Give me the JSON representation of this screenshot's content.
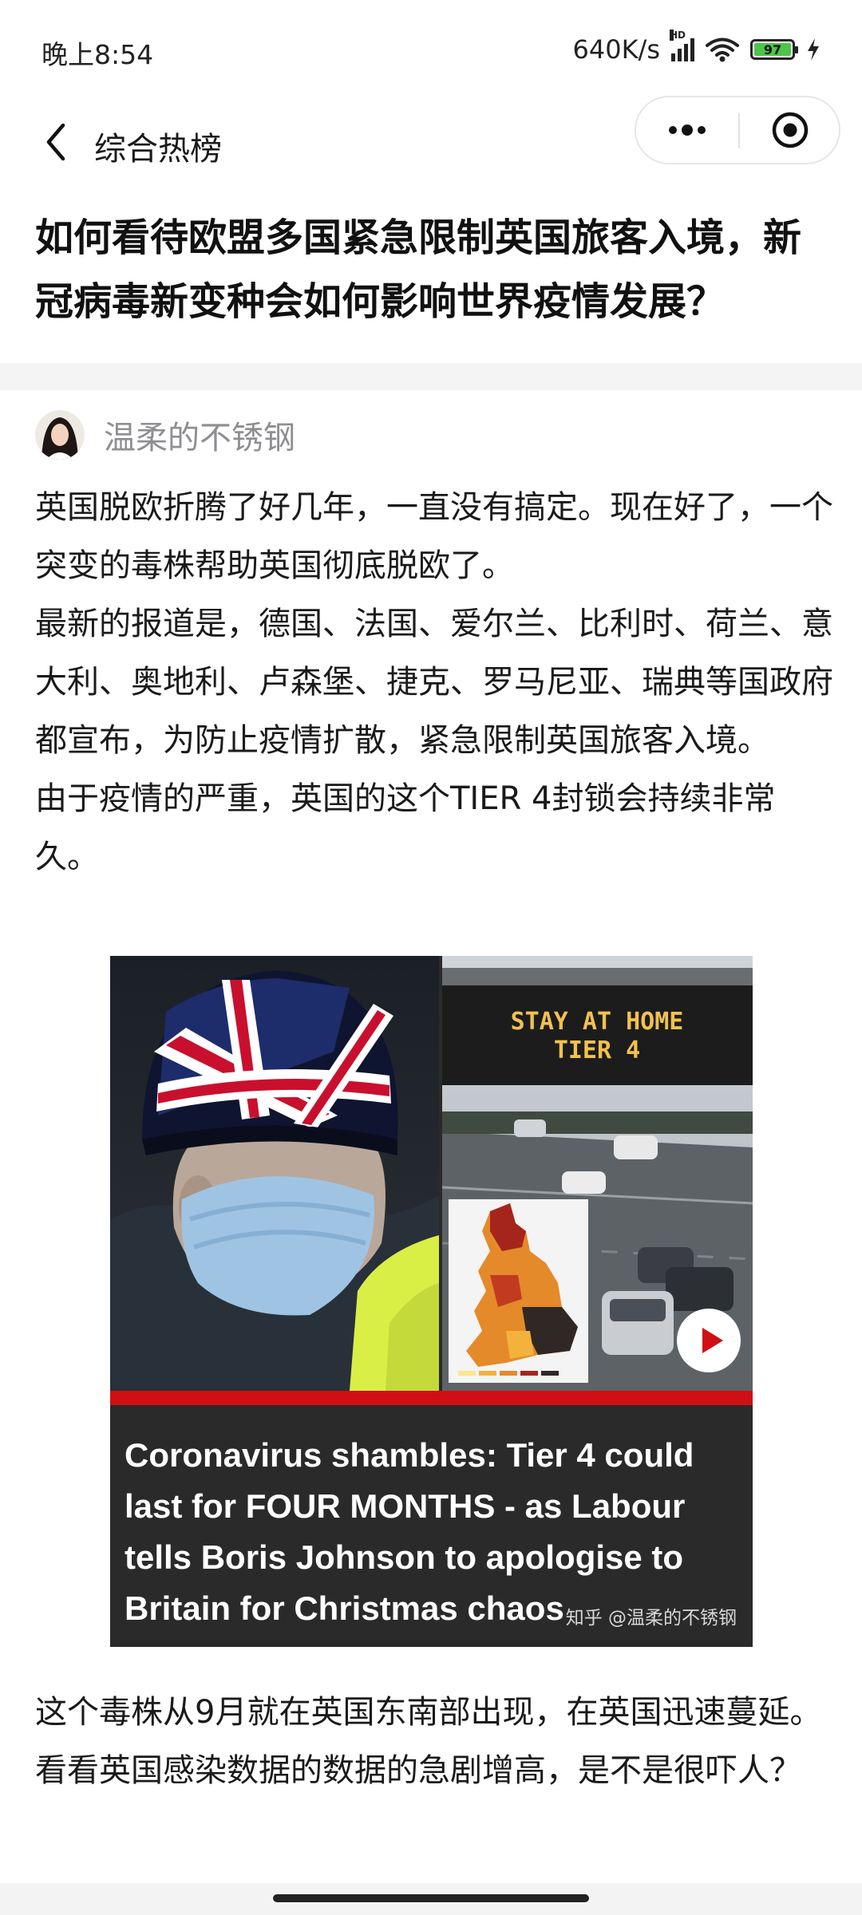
{
  "status_bar": {
    "time": "晚上8:54",
    "network_speed": "640K/s",
    "hd_label": "HD",
    "battery_level": "97",
    "icons": [
      "signal-icon",
      "wifi-icon",
      "battery-icon",
      "charging-icon"
    ]
  },
  "nav": {
    "title": "综合热榜",
    "icons": [
      "back-arrow-icon",
      "more-dots-icon",
      "close-target-icon"
    ]
  },
  "question": {
    "title": "如何看待欧盟多国紧急限制英国旅客入境，新冠病毒新变种会如何影响世界疫情发展？"
  },
  "answer": {
    "author_name": "温柔的不锈钢",
    "paragraph_1": "英国脱欧折腾了好几年，一直没有搞定。现在好了，一个突变的毒株帮助英国彻底脱欧了。\n最新的报道是，德国、法国、爱尔兰、比利时、荷兰、意大利、奥地利、卢森堡、捷克、罗马尼亚、瑞典等国政府都宣布，为防止疫情扩散，紧急限制英国旅客入境。\n由于疫情的严重，英国的这个TIER 4封锁会持续非常久。",
    "image": {
      "sign_line_1": "STAY AT HOME",
      "sign_line_2": "TIER 4",
      "headline": "Coronavirus shambles: Tier 4 could last for FOUR MONTHS - as Labour tells Boris Johnson to apologise to Britain for Christmas chaos",
      "watermark": "知乎 @温柔的不锈钢"
    },
    "paragraph_2": "这个毒株从9月就在英国东南部出现，在英国迅速蔓延。看看英国感染数据的数据的急剧增高，是不是很吓人？"
  },
  "colors": {
    "accent_red": "#d00f15",
    "divider": "#f4f4f5",
    "author_gray": "#8e8e93",
    "battery_green": "#4cc54a",
    "sign_amber": "#f2c14e"
  }
}
